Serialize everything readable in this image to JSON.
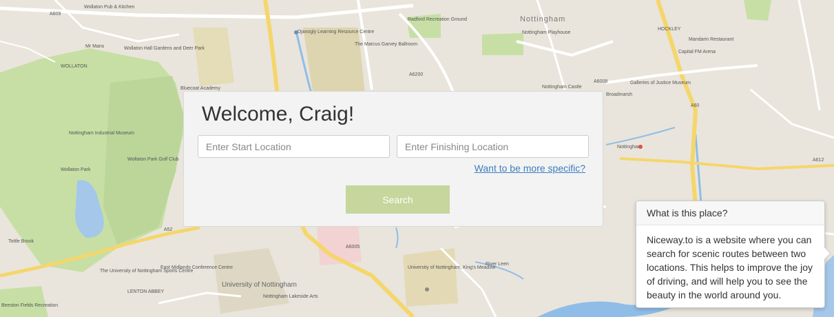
{
  "map": {
    "labels": {
      "city": "Nottingham",
      "hockley": "HOCKLEY",
      "wollaton": "WOLLATON",
      "lenton_abbey": "LENTON ABBEY",
      "university": "University of Nottingham",
      "wollaton_park": "Wollaton Park",
      "wollaton_hall": "Wollaton Hall Gardens and Deer Park",
      "industrial_museum": "Nottingham Industrial Museum",
      "golf_club": "Wollaton Park Golf Club",
      "playhouse": "Nottingham Playhouse",
      "castle": "Nottingham Castle",
      "broadmarsh": "Broadmarsh",
      "galleries": "Galleries of Justice Museum",
      "station": "Nottingham",
      "mandarin": "Mandarin Restaurant",
      "capital_fm": "Capital FM Arena",
      "east_midlands": "East Midlands Conference Centre",
      "sports_centre": "The University of Nottingham Sports Centre",
      "lakeside": "Nottingham Lakeside Arts",
      "kings_meadow": "University of Nottingham, King's Meadow",
      "radford": "Radford Recreation Ground",
      "djanogly": "Djanogly Learning Resource Centre",
      "marcus_garvey": "The Marcus Garvey Ballroom",
      "river_leen": "River Leen",
      "tottle_brook": "Tottle Brook",
      "beeston_fields": "Beeston Fields Recreation",
      "pub": "Wollaton Pub & Kitchen",
      "mr_mans": "Mr Mans",
      "bluecoat": "Bluecoat Academy",
      "a52": "A52",
      "a60": "A60",
      "a612": "A612",
      "a6005": "A6005",
      "a609": "A609",
      "a6200": "A6200",
      "a6008": "A6008"
    }
  },
  "panel": {
    "welcome": "Welcome, Craig!",
    "start_placeholder": "Enter Start Location",
    "finish_placeholder": "Enter Finishing Location",
    "more_specific_link": "Want to be more specific?",
    "search_button": "Search"
  },
  "popover": {
    "title": "What is this place?",
    "body": "Niceway.to is a website where you can search for scenic routes between two locations. This helps to improve the joy of driving, and will help you to see the beauty in the world around you."
  }
}
